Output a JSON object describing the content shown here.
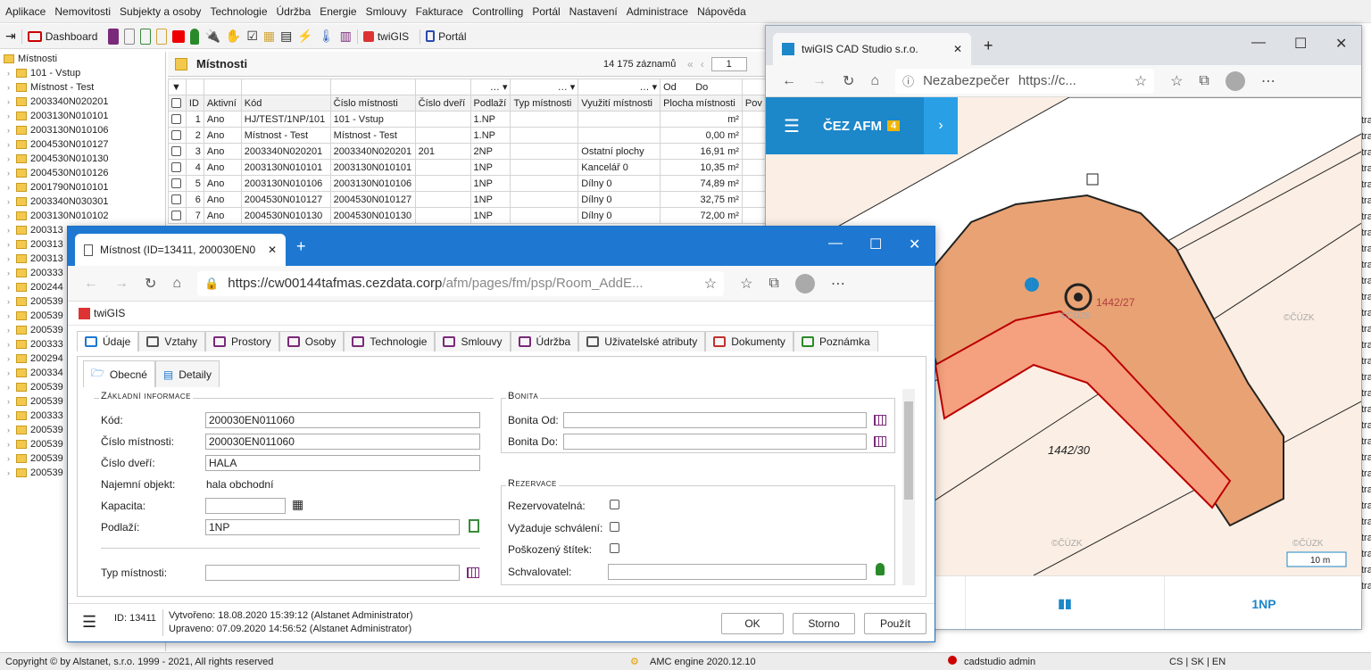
{
  "menu": [
    "Aplikace",
    "Nemovitosti",
    "Subjekty a osoby",
    "Technologie",
    "Údržba",
    "Energie",
    "Smlouvy",
    "Fakturace",
    "Controlling",
    "Portál",
    "Nastavení",
    "Administrace",
    "Nápověda"
  ],
  "toolbar": {
    "dashboard": "Dashboard",
    "twigis": "twiGIS",
    "portal": "Portál"
  },
  "tree": {
    "root": "Místnosti",
    "items": [
      "101 - Vstup",
      "Místnost - Test",
      "2003340N020201",
      "2003130N010101",
      "2003130N010106",
      "2004530N010127",
      "2004530N010130",
      "2004530N010126",
      "2001790N010101",
      "2003340N030301",
      "2003130N010102",
      "200313",
      "200313",
      "200313",
      "200333",
      "200244",
      "200539",
      "200539",
      "200539",
      "200333",
      "200294",
      "200334",
      "200539",
      "200539",
      "200333",
      "200539",
      "200539",
      "200539",
      "200539"
    ]
  },
  "grid": {
    "title": "Místnosti",
    "count": "14 175 záznamů",
    "page": "1",
    "filter_od": "Od",
    "filter_do": "Do",
    "columns": [
      "ID",
      "Aktivní",
      "Kód",
      "Číslo místnosti",
      "Číslo dveří",
      "Podlaží",
      "Typ místnosti",
      "Využití místnosti",
      "Plocha místnosti",
      "Pov"
    ],
    "rows": [
      [
        "1",
        "Ano",
        "HJ/TEST/1NP/101",
        "101 - Vstup",
        "",
        "1.NP",
        "",
        "",
        "m²"
      ],
      [
        "2",
        "Ano",
        "Místnost - Test",
        "Místnost - Test",
        "",
        "1.NP",
        "",
        "",
        "0,00 m²"
      ],
      [
        "3",
        "Ano",
        "2003340N020201",
        "2003340N020201",
        "201",
        "2NP",
        "",
        "Ostatní plochy",
        "16,91 m²"
      ],
      [
        "4",
        "Ano",
        "2003130N010101",
        "2003130N010101",
        "",
        "1NP",
        "",
        "Kancelář 0",
        "10,35 m²"
      ],
      [
        "5",
        "Ano",
        "2003130N010106",
        "2003130N010106",
        "",
        "1NP",
        "",
        "Dílny 0",
        "74,89 m²"
      ],
      [
        "6",
        "Ano",
        "2004530N010127",
        "2004530N010127",
        "",
        "1NP",
        "",
        "Dílny 0",
        "32,75 m²"
      ],
      [
        "7",
        "Ano",
        "2004530N010130",
        "2004530N010130",
        "",
        "1NP",
        "",
        "Dílny 0",
        "72,00 m²"
      ]
    ]
  },
  "gis": {
    "tab_title": "twiGIS CAD Studio s.r.o.",
    "security": "Nezabezpečer",
    "url": "https://c...",
    "brand": "ČEZ AFM",
    "badge": "4",
    "parcel_label": "1442/30",
    "room_label": "1442/27",
    "watermark": "©ČÚZK",
    "scale": "10 m",
    "floor": "1NP"
  },
  "dialog": {
    "tab_title": "Místnost (ID=13411, 200030EN0",
    "url_host": "https://cw00144tafmas.cezdata.corp",
    "url_path": "/afm/pages/fm/psp/Room_AddE...",
    "twigis": "twiGIS",
    "tabs": [
      "Údaje",
      "Vztahy",
      "Prostory",
      "Osoby",
      "Technologie",
      "Smlouvy",
      "Údržba",
      "Uživatelské atributy",
      "Dokumenty",
      "Poznámka"
    ],
    "subtabs": [
      "Obecné",
      "Detaily"
    ],
    "basic_legend": "Základní informace",
    "fields": {
      "kod_label": "Kód:",
      "kod": "200030EN011060",
      "cislo_label": "Číslo místnosti:",
      "cislo": "200030EN011060",
      "dvere_label": "Číslo dveří:",
      "dvere": "HALA",
      "najem_label": "Najemní objekt:",
      "najem": "hala obchodní",
      "kapacita_label": "Kapacita:",
      "kapacita": "",
      "podlazi_label": "Podlaží:",
      "podlazi": "1NP",
      "typ_label": "Typ místnosti:",
      "typ": ""
    },
    "bonita_legend": "Bonita",
    "bonita_od": "Bonita Od:",
    "bonita_do": "Bonita Do:",
    "rezervace_legend": "Rezervace",
    "rezervovatelna": "Rezervovatelná:",
    "vyzaduje": "Vyžaduje schválení:",
    "poskozeny": "Poškozený štítek:",
    "schvalovatel": "Schvalovatel:",
    "id_text": "ID: 13411",
    "created": "Vytvořeno: 18.08.2020 15:39:12 (Alstanet Administrator)",
    "updated": "Upraveno: 07.09.2020 14:56:52 (Alstanet Administrator)",
    "ok": "OK",
    "storno": "Storno",
    "pouzit": "Použít"
  },
  "status": {
    "copyright": "Copyright © by Alstanet, s.r.o. 1999 - 2021, All rights reserved",
    "engine": "AMC engine 2020.12.10",
    "user": "cadstudio admin",
    "langs": "CS | SK | EN"
  },
  "right_edge": [
    "tra",
    "tra",
    "tra",
    "tra",
    "tra",
    "tra",
    "tra",
    "tra",
    "tra",
    "tra",
    "tra",
    "tra",
    "tra",
    "tra",
    "tra",
    "tra",
    "tra",
    "tra",
    "tra",
    "tra",
    "tra",
    "tra",
    "tra",
    "tra",
    "tra",
    "tra",
    "tra",
    "tra",
    "tra",
    "tra"
  ]
}
